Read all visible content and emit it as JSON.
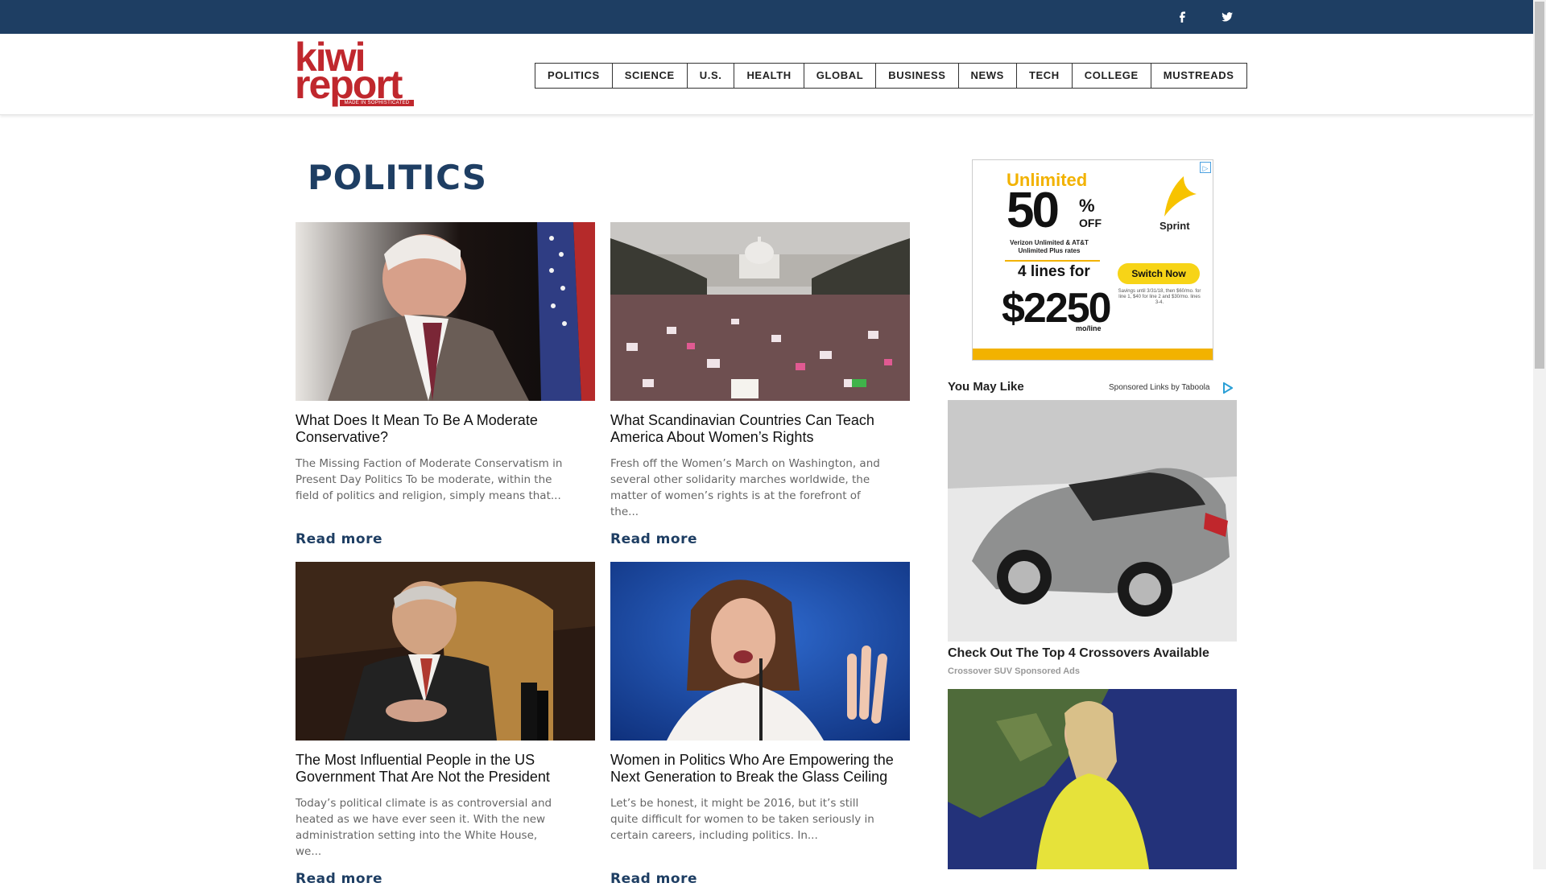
{
  "site": {
    "logo_line1": "kiwi",
    "logo_line2": "report",
    "logo_tagline": "MADE IN SOPHISTICATED"
  },
  "topbar": {
    "social": [
      {
        "name": "facebook-icon",
        "glyph": "f"
      },
      {
        "name": "twitter-icon",
        "glyph": "t"
      }
    ]
  },
  "nav": {
    "items": [
      "POLITICS",
      "SCIENCE",
      "U.S.",
      "HEALTH",
      "GLOBAL",
      "BUSINESS",
      "NEWS",
      "TECH",
      "COLLEGE",
      "MUSTREADS"
    ]
  },
  "main": {
    "title": "POLITICS",
    "read_more": "Read more",
    "articles": [
      {
        "title": "What Does It Mean To Be A Moderate Conservative?",
        "excerpt": "The Missing Faction of Moderate Conservatism in Present Day Politics To be moderate, within the field of politics and religion, simply means that..."
      },
      {
        "title": "What Scandinavian Countries Can Teach America About Women’s Rights",
        "excerpt": "Fresh off the Women’s March on Washington, and several other solidarity marches worldwide, the matter of women’s rights is at the forefront of the..."
      },
      {
        "title": "The Most Influential People in the US Government That Are Not the President",
        "excerpt": "Today’s political climate is as controversial and heated as we have ever seen it. With the new administration setting into the White House, we..."
      },
      {
        "title": "Women in Politics Who Are Empowering the Next Generation to Break the Glass Ceiling",
        "excerpt": "Let’s be honest, it might be 2016, but it’s still quite difficult for women to be taken seriously in certain careers, including politics. In..."
      }
    ]
  },
  "ad": {
    "unlimited": "Unlimited",
    "big": "50",
    "pct": "%",
    "off": "OFF",
    "line1": "Verizon Unlimited & AT&T Unlimited Plus rates",
    "four_lines": "4 lines for",
    "price": "$2250",
    "mo": "mo/line",
    "brand": "Sprint",
    "button": "Switch Now",
    "fine": "Savings until 3/31/18, then $60/mo. for line 1, $40 for line 2 and $30/mo. lines 3-4.",
    "badge": "▷"
  },
  "sidebar": {
    "you_may_like": "You May Like",
    "sponsored": "Sponsored Links by Taboola",
    "promo_title": "Check Out The Top 4 Crossovers Available",
    "promo_sub": "Crossover SUV Sponsored Ads"
  },
  "colors": {
    "navy": "#1e3e63",
    "brand_red": "#c0272d",
    "ad_yellow": "#f2b200"
  }
}
